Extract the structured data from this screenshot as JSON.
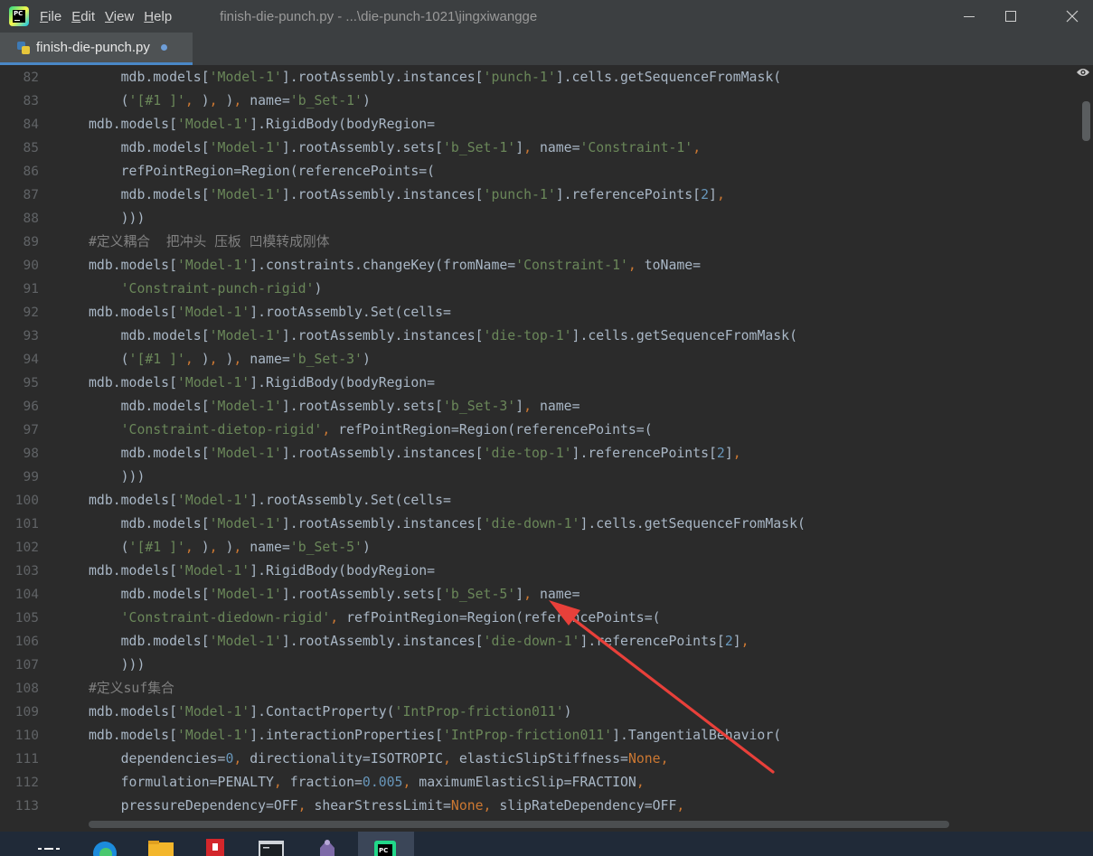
{
  "menu": {
    "items": [
      {
        "mnemonic": "F",
        "rest": "ile"
      },
      {
        "mnemonic": "E",
        "rest": "dit"
      },
      {
        "mnemonic": "V",
        "rest": "iew"
      },
      {
        "mnemonic": "H",
        "rest": "elp"
      }
    ]
  },
  "window_title": "finish-die-punch.py - ...\\die-punch-1021\\jingxiwangge",
  "tab": {
    "label": "finish-die-punch.py",
    "modified": true
  },
  "icons": {
    "app": "pycharm-logo-icon",
    "tab": "python-file-icon",
    "reader": "eye-icon",
    "taskbar": [
      "task-view-icon",
      "edge-browser-icon",
      "file-explorer-icon",
      "pdf-reader-icon",
      "terminal-icon",
      "app-icon",
      "pycharm-icon"
    ]
  },
  "colors": {
    "editor_bg": "#2b2b2b",
    "chrome_bg": "#3c3f41",
    "string": "#6a8759",
    "number": "#6897bb",
    "keyword": "#cc7832",
    "comment": "#808080",
    "plain": "#a9b7c6",
    "arrow": "#e8403a"
  },
  "editor": {
    "lines": [
      {
        "num": "82",
        "tokens": [
          [
            "p",
            "    mdb.models["
          ],
          [
            "s",
            "'Model-1'"
          ],
          [
            "p",
            "].rootAssembly.instances["
          ],
          [
            "s",
            "'punch-1'"
          ],
          [
            "p",
            "].cells.getSequenceFromMask("
          ]
        ]
      },
      {
        "num": "83",
        "tokens": [
          [
            "p",
            "    ("
          ],
          [
            "s",
            "'[#1 ]'"
          ],
          [
            "k",
            ","
          ],
          [
            "p",
            " )"
          ],
          [
            "k",
            ","
          ],
          [
            "p",
            " )"
          ],
          [
            "k",
            ","
          ],
          [
            "p",
            " name="
          ],
          [
            "s",
            "'b_Set-1'"
          ],
          [
            "p",
            ")"
          ]
        ]
      },
      {
        "num": "84",
        "tokens": [
          [
            "p",
            "mdb.models["
          ],
          [
            "s",
            "'Model-1'"
          ],
          [
            "p",
            "].RigidBody(bodyRegion="
          ]
        ]
      },
      {
        "num": "85",
        "tokens": [
          [
            "p",
            "    mdb.models["
          ],
          [
            "s",
            "'Model-1'"
          ],
          [
            "p",
            "].rootAssembly.sets["
          ],
          [
            "s",
            "'b_Set-1'"
          ],
          [
            "p",
            "]"
          ],
          [
            "k",
            ","
          ],
          [
            "p",
            " name="
          ],
          [
            "s",
            "'Constraint-1'"
          ],
          [
            "k",
            ","
          ]
        ]
      },
      {
        "num": "86",
        "tokens": [
          [
            "p",
            "    refPointRegion=Region(referencePoints=("
          ]
        ]
      },
      {
        "num": "87",
        "tokens": [
          [
            "p",
            "    mdb.models["
          ],
          [
            "s",
            "'Model-1'"
          ],
          [
            "p",
            "].rootAssembly.instances["
          ],
          [
            "s",
            "'punch-1'"
          ],
          [
            "p",
            "].referencePoints["
          ],
          [
            "n",
            "2"
          ],
          [
            "p",
            "]"
          ],
          [
            "k",
            ","
          ]
        ]
      },
      {
        "num": "88",
        "tokens": [
          [
            "p",
            "    )))"
          ]
        ]
      },
      {
        "num": "89",
        "tokens": [
          [
            "c",
            "#定义耦合  把冲头 压板 凹模转成刚体"
          ]
        ]
      },
      {
        "num": "90",
        "tokens": [
          [
            "p",
            "mdb.models["
          ],
          [
            "s",
            "'Model-1'"
          ],
          [
            "p",
            "].constraints.changeKey(fromName="
          ],
          [
            "s",
            "'Constraint-1'"
          ],
          [
            "k",
            ","
          ],
          [
            "p",
            " toName="
          ]
        ]
      },
      {
        "num": "91",
        "tokens": [
          [
            "s",
            "    'Constraint-punch-rigid'"
          ],
          [
            "p",
            ")"
          ]
        ]
      },
      {
        "num": "92",
        "tokens": [
          [
            "p",
            "mdb.models["
          ],
          [
            "s",
            "'Model-1'"
          ],
          [
            "p",
            "].rootAssembly.Set(cells="
          ]
        ]
      },
      {
        "num": "93",
        "tokens": [
          [
            "p",
            "    mdb.models["
          ],
          [
            "s",
            "'Model-1'"
          ],
          [
            "p",
            "].rootAssembly.instances["
          ],
          [
            "s",
            "'die-top-1'"
          ],
          [
            "p",
            "].cells.getSequenceFromMask("
          ]
        ]
      },
      {
        "num": "94",
        "tokens": [
          [
            "p",
            "    ("
          ],
          [
            "s",
            "'[#1 ]'"
          ],
          [
            "k",
            ","
          ],
          [
            "p",
            " )"
          ],
          [
            "k",
            ","
          ],
          [
            "p",
            " )"
          ],
          [
            "k",
            ","
          ],
          [
            "p",
            " name="
          ],
          [
            "s",
            "'b_Set-3'"
          ],
          [
            "p",
            ")"
          ]
        ]
      },
      {
        "num": "95",
        "tokens": [
          [
            "p",
            "mdb.models["
          ],
          [
            "s",
            "'Model-1'"
          ],
          [
            "p",
            "].RigidBody(bodyRegion="
          ]
        ]
      },
      {
        "num": "96",
        "tokens": [
          [
            "p",
            "    mdb.models["
          ],
          [
            "s",
            "'Model-1'"
          ],
          [
            "p",
            "].rootAssembly.sets["
          ],
          [
            "s",
            "'b_Set-3'"
          ],
          [
            "p",
            "]"
          ],
          [
            "k",
            ","
          ],
          [
            "p",
            " name="
          ]
        ]
      },
      {
        "num": "97",
        "tokens": [
          [
            "s",
            "    'Constraint-dietop-rigid'"
          ],
          [
            "k",
            ","
          ],
          [
            "p",
            " refPointRegion=Region(referencePoints=("
          ]
        ]
      },
      {
        "num": "98",
        "tokens": [
          [
            "p",
            "    mdb.models["
          ],
          [
            "s",
            "'Model-1'"
          ],
          [
            "p",
            "].rootAssembly.instances["
          ],
          [
            "s",
            "'die-top-1'"
          ],
          [
            "p",
            "].referencePoints["
          ],
          [
            "n",
            "2"
          ],
          [
            "p",
            "]"
          ],
          [
            "k",
            ","
          ]
        ]
      },
      {
        "num": "99",
        "tokens": [
          [
            "p",
            "    )))"
          ]
        ]
      },
      {
        "num": "100",
        "tokens": [
          [
            "p",
            "mdb.models["
          ],
          [
            "s",
            "'Model-1'"
          ],
          [
            "p",
            "].rootAssembly.Set(cells="
          ]
        ]
      },
      {
        "num": "101",
        "tokens": [
          [
            "p",
            "    mdb.models["
          ],
          [
            "s",
            "'Model-1'"
          ],
          [
            "p",
            "].rootAssembly.instances["
          ],
          [
            "s",
            "'die-down-1'"
          ],
          [
            "p",
            "].cells.getSequenceFromMask("
          ]
        ]
      },
      {
        "num": "102",
        "tokens": [
          [
            "p",
            "    ("
          ],
          [
            "s",
            "'[#1 ]'"
          ],
          [
            "k",
            ","
          ],
          [
            "p",
            " )"
          ],
          [
            "k",
            ","
          ],
          [
            "p",
            " )"
          ],
          [
            "k",
            ","
          ],
          [
            "p",
            " name="
          ],
          [
            "s",
            "'b_Set-5'"
          ],
          [
            "p",
            ")"
          ]
        ]
      },
      {
        "num": "103",
        "tokens": [
          [
            "p",
            "mdb.models["
          ],
          [
            "s",
            "'Model-1'"
          ],
          [
            "p",
            "].RigidBody(bodyRegion="
          ]
        ]
      },
      {
        "num": "104",
        "tokens": [
          [
            "p",
            "    mdb.models["
          ],
          [
            "s",
            "'Model-1'"
          ],
          [
            "p",
            "].rootAssembly.sets["
          ],
          [
            "s",
            "'b_Set-5'"
          ],
          [
            "p",
            "]"
          ],
          [
            "k",
            ","
          ],
          [
            "p",
            " name="
          ]
        ]
      },
      {
        "num": "105",
        "tokens": [
          [
            "s",
            "    'Constraint-diedown-rigid'"
          ],
          [
            "k",
            ","
          ],
          [
            "p",
            " refPointRegion=Region(referencePoints=("
          ]
        ]
      },
      {
        "num": "106",
        "tokens": [
          [
            "p",
            "    mdb.models["
          ],
          [
            "s",
            "'Model-1'"
          ],
          [
            "p",
            "].rootAssembly.instances["
          ],
          [
            "s",
            "'die-down-1'"
          ],
          [
            "p",
            "].referencePoints["
          ],
          [
            "n",
            "2"
          ],
          [
            "p",
            "]"
          ],
          [
            "k",
            ","
          ]
        ]
      },
      {
        "num": "107",
        "tokens": [
          [
            "p",
            "    )))"
          ]
        ]
      },
      {
        "num": "108",
        "tokens": [
          [
            "c",
            "#定义suf集合"
          ]
        ]
      },
      {
        "num": "109",
        "tokens": [
          [
            "p",
            "mdb.models["
          ],
          [
            "s",
            "'Model-1'"
          ],
          [
            "p",
            "].ContactProperty("
          ],
          [
            "s",
            "'IntProp-friction011'"
          ],
          [
            "p",
            ")"
          ]
        ]
      },
      {
        "num": "110",
        "tokens": [
          [
            "p",
            "mdb.models["
          ],
          [
            "s",
            "'Model-1'"
          ],
          [
            "p",
            "].interactionProperties["
          ],
          [
            "s",
            "'IntProp-friction011'"
          ],
          [
            "p",
            "].TangentialBehavior("
          ]
        ]
      },
      {
        "num": "111",
        "tokens": [
          [
            "p",
            "    dependencies="
          ],
          [
            "n",
            "0"
          ],
          [
            "k",
            ","
          ],
          [
            "p",
            " directionality=ISOTROPIC"
          ],
          [
            "k",
            ","
          ],
          [
            "p",
            " elasticSlipStiffness="
          ],
          [
            "k",
            "None"
          ],
          [
            "k",
            ","
          ]
        ]
      },
      {
        "num": "112",
        "tokens": [
          [
            "p",
            "    formulation=PENALTY"
          ],
          [
            "k",
            ","
          ],
          [
            "p",
            " fraction="
          ],
          [
            "n",
            "0.005"
          ],
          [
            "k",
            ","
          ],
          [
            "p",
            " maximumElasticSlip=FRACTION"
          ],
          [
            "k",
            ","
          ]
        ]
      },
      {
        "num": "113",
        "tokens": [
          [
            "p",
            "    pressureDependency=OFF"
          ],
          [
            "k",
            ","
          ],
          [
            "p",
            " shearStressLimit="
          ],
          [
            "k",
            "None"
          ],
          [
            "k",
            ","
          ],
          [
            "p",
            " slipRateDependency=OFF"
          ],
          [
            "k",
            ","
          ]
        ]
      }
    ]
  }
}
